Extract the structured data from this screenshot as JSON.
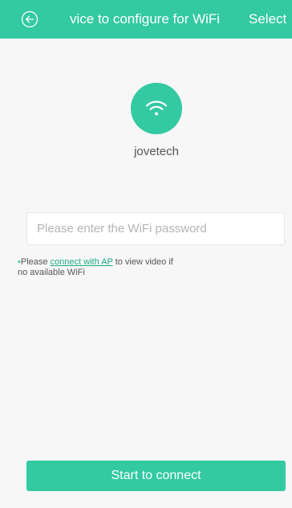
{
  "header": {
    "back_icon": "back-arrow-circle-icon",
    "title": "vice to configure for WiFi",
    "action_label": "Select"
  },
  "device": {
    "icon": "wifi-icon",
    "name": "jovetech"
  },
  "password": {
    "value": "",
    "placeholder": "Please enter the WiFi password"
  },
  "tip": {
    "bullet": "•",
    "prefix": "Please ",
    "link": "connect with AP",
    "line1_suffix": " to view video if",
    "line2": "no available WiFi"
  },
  "footer": {
    "start_label": "Start to connect"
  },
  "colors": {
    "accent": "#33c9a2",
    "link": "#1faa86",
    "background": "#f7f7f7"
  }
}
